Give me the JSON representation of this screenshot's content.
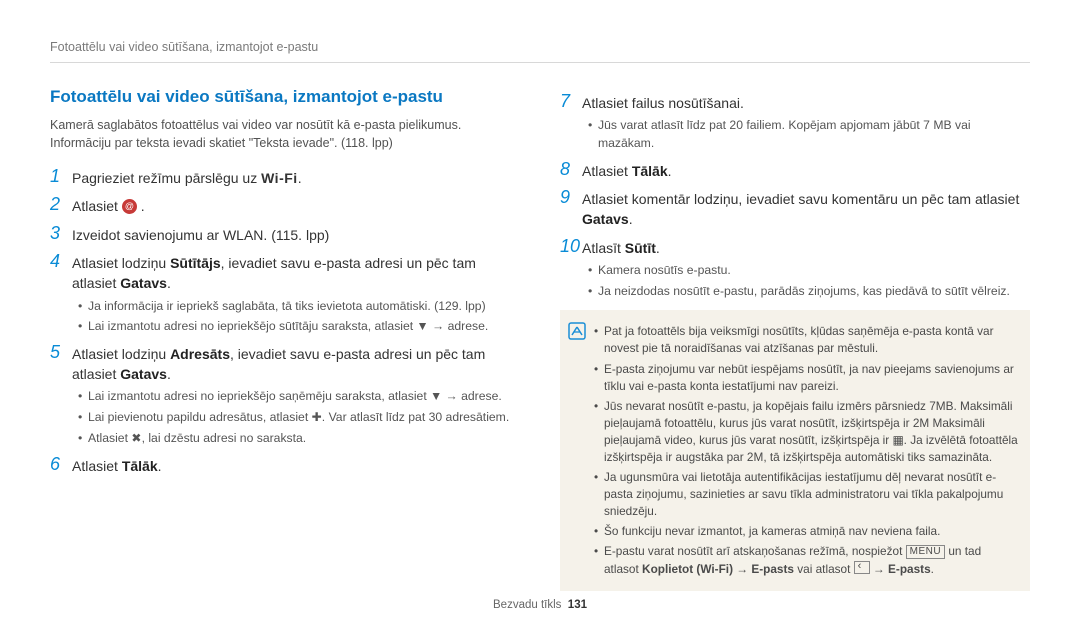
{
  "header": "Fotoattēlu vai video sūtīšana, izmantojot e-pastu",
  "title": "Fotoattēlu vai video sūtīšana, izmantojot e-pastu",
  "intro": "Kamerā saglabātos fotoattēlus vai video var nosūtīt kā e-pasta pielikumus. Informāciju par teksta ievadi skatiet \"Teksta ievade\". (118. lpp)",
  "steps_left": [
    {
      "n": "1",
      "pre": "Pagrieziet režīmu pārslēgu uz ",
      "wifi": "Wi-Fi",
      "post": "."
    },
    {
      "n": "2",
      "pre": "Atlasiet ",
      "circle_icon": true,
      "post": " ."
    },
    {
      "n": "3",
      "pre": "Izveidot savienojumu ar WLAN. (115. lpp)"
    },
    {
      "n": "4",
      "pre": "Atlasiet lodziņu ",
      "bold1": "Sūtītājs",
      "mid": ", ievadiet savu e-pasta adresi un pēc tam atlasiet ",
      "bold2": "Gatavs",
      "post": ".",
      "bullets": [
        "Ja informācija ir iepriekš saglabāta, tā tiks ievietota automātiski. (129. lpp)",
        "Lai izmantotu adresi no iepriekšējo sūtītāju saraksta, atlasiet ▼ → adrese."
      ]
    },
    {
      "n": "5",
      "pre": "Atlasiet lodziņu ",
      "bold1": "Adresāts",
      "mid": ", ievadiet savu e-pasta adresi un pēc tam atlasiet ",
      "bold2": "Gatavs",
      "post": ".",
      "bullets": [
        "Lai izmantotu adresi no iepriekšējo saņēmēju saraksta, atlasiet ▼ → adrese.",
        "Lai pievienotu papildu adresātus, atlasiet ✚. Var atlasīt līdz pat 30 adresātiem.",
        "Atlasiet ✖, lai dzēstu adresi no saraksta."
      ]
    },
    {
      "n": "6",
      "pre": "Atlasiet ",
      "bold1": "Tālāk",
      "post": "."
    }
  ],
  "steps_right": [
    {
      "n": "7",
      "pre": "Atlasiet failus nosūtīšanai.",
      "bullets": [
        "Jūs varat atlasīt līdz pat 20 failiem. Kopējam apjomam jābūt 7 MB vai mazākam."
      ]
    },
    {
      "n": "8",
      "pre": "Atlasiet ",
      "bold1": "Tālāk",
      "post": "."
    },
    {
      "n": "9",
      "pre": "Atlasiet komentār lodziņu, ievadiet savu komentāru un pēc tam atlasiet ",
      "bold1": "Gatavs",
      "post": "."
    },
    {
      "n": "10",
      "pre": "Atlasīt ",
      "bold1": "Sūtīt",
      "post": ".",
      "bullets": [
        "Kamera nosūtīs e-pastu.",
        "Ja neizdodas nosūtīt e-pastu, parādās ziņojums, kas piedāvā to sūtīt vēlreiz."
      ]
    }
  ],
  "notes": [
    "Pat ja fotoattēls bija veiksmīgi nosūtīts, kļūdas saņēmēja e-pasta kontā var novest pie tā noraidīšanas vai atzīšanas par mēstuli.",
    "E-pasta ziņojumu var nebūt iespējams nosūtīt, ja nav pieejams savienojums ar tīklu vai e-pasta konta iestatījumi nav pareizi.",
    "Jūs nevarat nosūtīt e-pastu, ja kopējais failu izmērs pārsniedz 7MB. Maksimāli pieļaujamā fotoattēlu, kurus jūs varat nosūtīt, izšķirtspēja ir 2M Maksimāli pieļaujamā video, kurus jūs varat nosūtīt, izšķirtspēja ir ▦. Ja izvēlētā fotoattēla izšķirtspēja ir augstāka par 2M, tā izšķirtspēja automātiski tiks samazināta.",
    "Ja ugunsmūra vai lietotāja autentifikācijas iestatījumu dēļ nevarat nosūtīt e-pasta ziņojumu, sazinieties ar savu tīkla administratoru vai tīkla pakalpojumu sniedzēju.",
    "Šo funkciju nevar izmantot, ja kameras atmiņā nav neviena faila."
  ],
  "note_last_pre": "E-pastu varat nosūtīt arī atskaņošanas režīmā, nospiežot ",
  "note_last_menu": "MENU",
  "note_last_mid": " un tad atlasot ",
  "note_last_bold": "Koplietot (Wi-Fi) → E-pasts",
  "note_last_or": " vai atlasot ",
  "note_last_end": " → ",
  "note_last_end2": "E-pasts",
  "footer_label": "Bezvadu tīkls",
  "footer_page": "131"
}
